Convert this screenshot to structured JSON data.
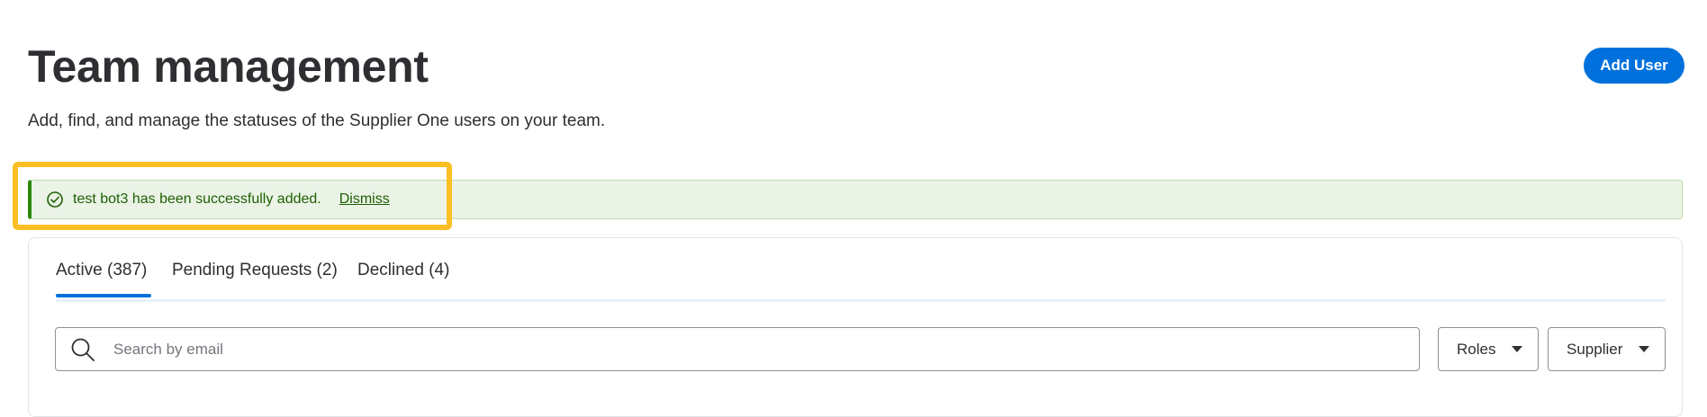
{
  "header": {
    "title": "Team management",
    "subtitle": "Add, find, and manage the statuses of the Supplier One users on your team.",
    "add_user_label": "Add User"
  },
  "alert": {
    "icon": "check-circle-icon",
    "message": "test bot3 has been successfully added.",
    "dismiss_label": "Dismiss",
    "color": "#2a8703"
  },
  "tabs": [
    {
      "label": "Active (387)",
      "active": true
    },
    {
      "label": "Pending Requests (2)",
      "active": false
    },
    {
      "label": "Declined (4)",
      "active": false
    }
  ],
  "search": {
    "icon": "search-icon",
    "placeholder": "Search by email",
    "value": ""
  },
  "filters": {
    "roles_label": "Roles",
    "supplier_label": "Supplier"
  },
  "colors": {
    "primary": "#0071dc",
    "highlight": "#fbbf24",
    "success_bg": "#eaf3e6"
  }
}
